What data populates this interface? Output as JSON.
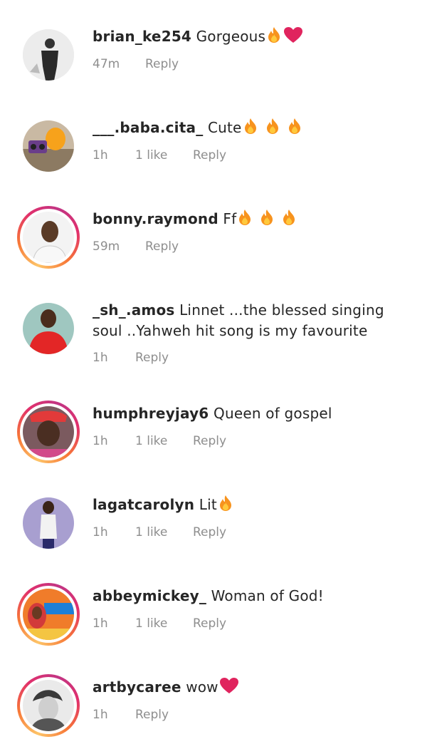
{
  "comments": [
    {
      "username": "brian_ke254",
      "text": "Gorgeous",
      "emojis": [
        "fire-icon",
        "heart-icon"
      ],
      "time": "47m",
      "likes": "",
      "reply": "Reply",
      "story_ring": false
    },
    {
      "username": "___.baba.cita_",
      "text": "Cute",
      "emojis": [
        "fire-icon",
        "fire-icon",
        "fire-icon"
      ],
      "time": "1h",
      "likes": "1 like",
      "reply": "Reply",
      "story_ring": false
    },
    {
      "username": "bonny.raymond",
      "text": "Ff",
      "emojis": [
        "fire-icon",
        "fire-icon",
        "fire-icon"
      ],
      "time": "59m",
      "likes": "",
      "reply": "Reply",
      "story_ring": true
    },
    {
      "username": "_sh_.amos",
      "text": "Linnet ...the blessed singing soul ..Yahweh hit song is my favourite",
      "emojis": [],
      "time": "1h",
      "likes": "",
      "reply": "Reply",
      "story_ring": false
    },
    {
      "username": "humphreyjay6",
      "text": "Queen of gospel",
      "emojis": [],
      "time": "1h",
      "likes": "1 like",
      "reply": "Reply",
      "story_ring": true
    },
    {
      "username": "lagatcarolyn",
      "text": "Lit",
      "emojis": [
        "fire-icon"
      ],
      "time": "1h",
      "likes": "1 like",
      "reply": "Reply",
      "story_ring": false
    },
    {
      "username": "abbeymickey_",
      "text": "Woman of God!",
      "emojis": [],
      "time": "1h",
      "likes": "1 like",
      "reply": "Reply",
      "story_ring": true
    },
    {
      "username": "artbycaree",
      "text": "wow",
      "emojis": [
        "heart-icon"
      ],
      "time": "1h",
      "likes": "",
      "reply": "Reply",
      "story_ring": true
    }
  ],
  "colors": {
    "username": "#262626",
    "meta": "#8e8e8e",
    "fire": "#f7931e",
    "heart": "#e0245e",
    "ring_start": "#fdc468",
    "ring_end": "#c13584"
  }
}
